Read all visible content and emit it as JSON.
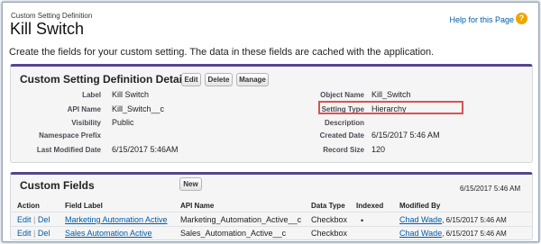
{
  "header": {
    "breadcrumb": "Custom Setting Definition",
    "title": "Kill Switch",
    "help_link": "Help for this Page",
    "help_icon": "question-icon"
  },
  "intro_text": "Create the fields for your custom setting. The data in these fields are cached with the application.",
  "detail": {
    "title": "Custom Setting Definition Detail",
    "buttons": {
      "edit": "Edit",
      "delete": "Delete",
      "manage": "Manage"
    },
    "fields_left": [
      {
        "label": "Label",
        "value": "Kill Switch"
      },
      {
        "label": "API Name",
        "value": "Kill_Switch__c"
      },
      {
        "label": "Visibility",
        "value": "Public"
      },
      {
        "label": "Namespace Prefix",
        "value": ""
      },
      {
        "label": "Last Modified Date",
        "value": "6/15/2017 5:46AM"
      }
    ],
    "fields_right": [
      {
        "label": "Object Name",
        "value": "Kill_Switch"
      },
      {
        "label": "Setting Type",
        "value": "Hierarchy"
      },
      {
        "label": "Description",
        "value": ""
      },
      {
        "label": "Created Date",
        "value": "6/15/2017 5:46 AM"
      },
      {
        "label": "Record Size",
        "value": "120"
      }
    ]
  },
  "custom_fields": {
    "title": "Custom Fields",
    "new_button": "New",
    "timestamp": "6/15/2017 5:46 AM",
    "columns": [
      "Action",
      "Field Label",
      "API Name",
      "Data Type",
      "Indexed",
      "Modified By"
    ],
    "rows": [
      {
        "edit": "Edit",
        "sep": "|",
        "del": "Del",
        "field_label": "Marketing Automation Active",
        "api_name": "Marketing_Automation_Active__c",
        "data_type": "Checkbox",
        "indexed": "•",
        "modified_by_name": "Chad Wade",
        "modified_by_date": ", 6/15/2017 5:46 AM"
      },
      {
        "edit": "Edit",
        "sep": "|",
        "del": "Del",
        "field_label": "Sales Automation Active",
        "api_name": "Sales_Automation_Active__c",
        "data_type": "Checkbox",
        "indexed": "",
        "modified_by_name": "Chad Wade",
        "modified_by_date": ", 6/15/2017 5:46 AM"
      }
    ]
  }
}
